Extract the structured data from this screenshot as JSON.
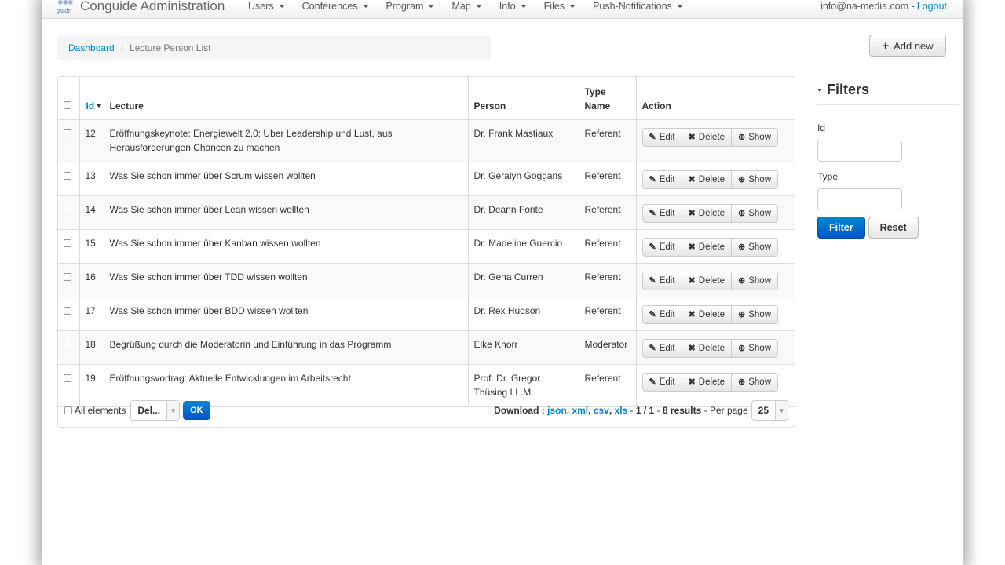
{
  "navbar": {
    "logo_word": "guide",
    "title": "Conguide Administration",
    "menus": [
      {
        "label": "Users"
      },
      {
        "label": "Conferences"
      },
      {
        "label": "Program"
      },
      {
        "label": "Map"
      },
      {
        "label": "Info"
      },
      {
        "label": "Files"
      },
      {
        "label": "Push-Notifications"
      }
    ],
    "user_email": "info@na-media.com -",
    "logout_label": "Logout"
  },
  "breadcrumb": {
    "home": "Dashboard",
    "separator": "/",
    "current": "Lecture Person List"
  },
  "add_new_label": "Add new",
  "table": {
    "columns": {
      "id": "Id",
      "lecture": "Lecture",
      "person": "Person",
      "type_name": "Type Name",
      "action": "Action"
    },
    "action_labels": {
      "edit": "Edit",
      "delete": "Delete",
      "show": "Show"
    },
    "rows": [
      {
        "id": "12",
        "lecture": "Eröffnungskeynote: Energiewelt 2.0: Über Leadership und Lust, aus Herausforderungen Chancen zu machen",
        "person": "Dr. Frank Mastiaux",
        "type": "Referent"
      },
      {
        "id": "13",
        "lecture": "Was Sie schon immer über Scrum wissen wollten",
        "person": "Dr. Geralyn Goggans",
        "type": "Referent"
      },
      {
        "id": "14",
        "lecture": "Was Sie schon immer über Lean wissen wollten",
        "person": "Dr. Deann Fonte",
        "type": "Referent"
      },
      {
        "id": "15",
        "lecture": "Was Sie schon immer über Kanban wissen wollten",
        "person": "Dr. Madeline Guercio",
        "type": "Referent"
      },
      {
        "id": "16",
        "lecture": "Was Sie schon immer über TDD wissen wollten",
        "person": "Dr. Gena Curren",
        "type": "Referent"
      },
      {
        "id": "17",
        "lecture": "Was Sie schon immer über BDD wissen wollten",
        "person": "Dr. Rex Hudson",
        "type": "Referent"
      },
      {
        "id": "18",
        "lecture": "Begrüßung durch die Moderatorin und Einführung in das Programm",
        "person": "Elke Knorr",
        "type": "Moderator"
      },
      {
        "id": "19",
        "lecture": "Eröffnungsvortrag: Aktuelle Entwicklungen im Arbeitsrecht",
        "person": "Prof. Dr. Gregor Thüsing LL.M.",
        "type": "Referent"
      }
    ]
  },
  "footer": {
    "all_elements_label": "All elements",
    "batch_action_value": "Del...",
    "ok_label": "OK",
    "download_label": "Download :",
    "formats": [
      "json",
      "xml",
      "csv",
      "xls"
    ],
    "pagination": "1 / 1",
    "results": "8 results",
    "per_page_label": "Per page",
    "per_page_value": "25"
  },
  "filters": {
    "title": "Filters",
    "id_label": "Id",
    "type_label": "Type",
    "filter_button": "Filter",
    "reset_button": "Reset"
  }
}
